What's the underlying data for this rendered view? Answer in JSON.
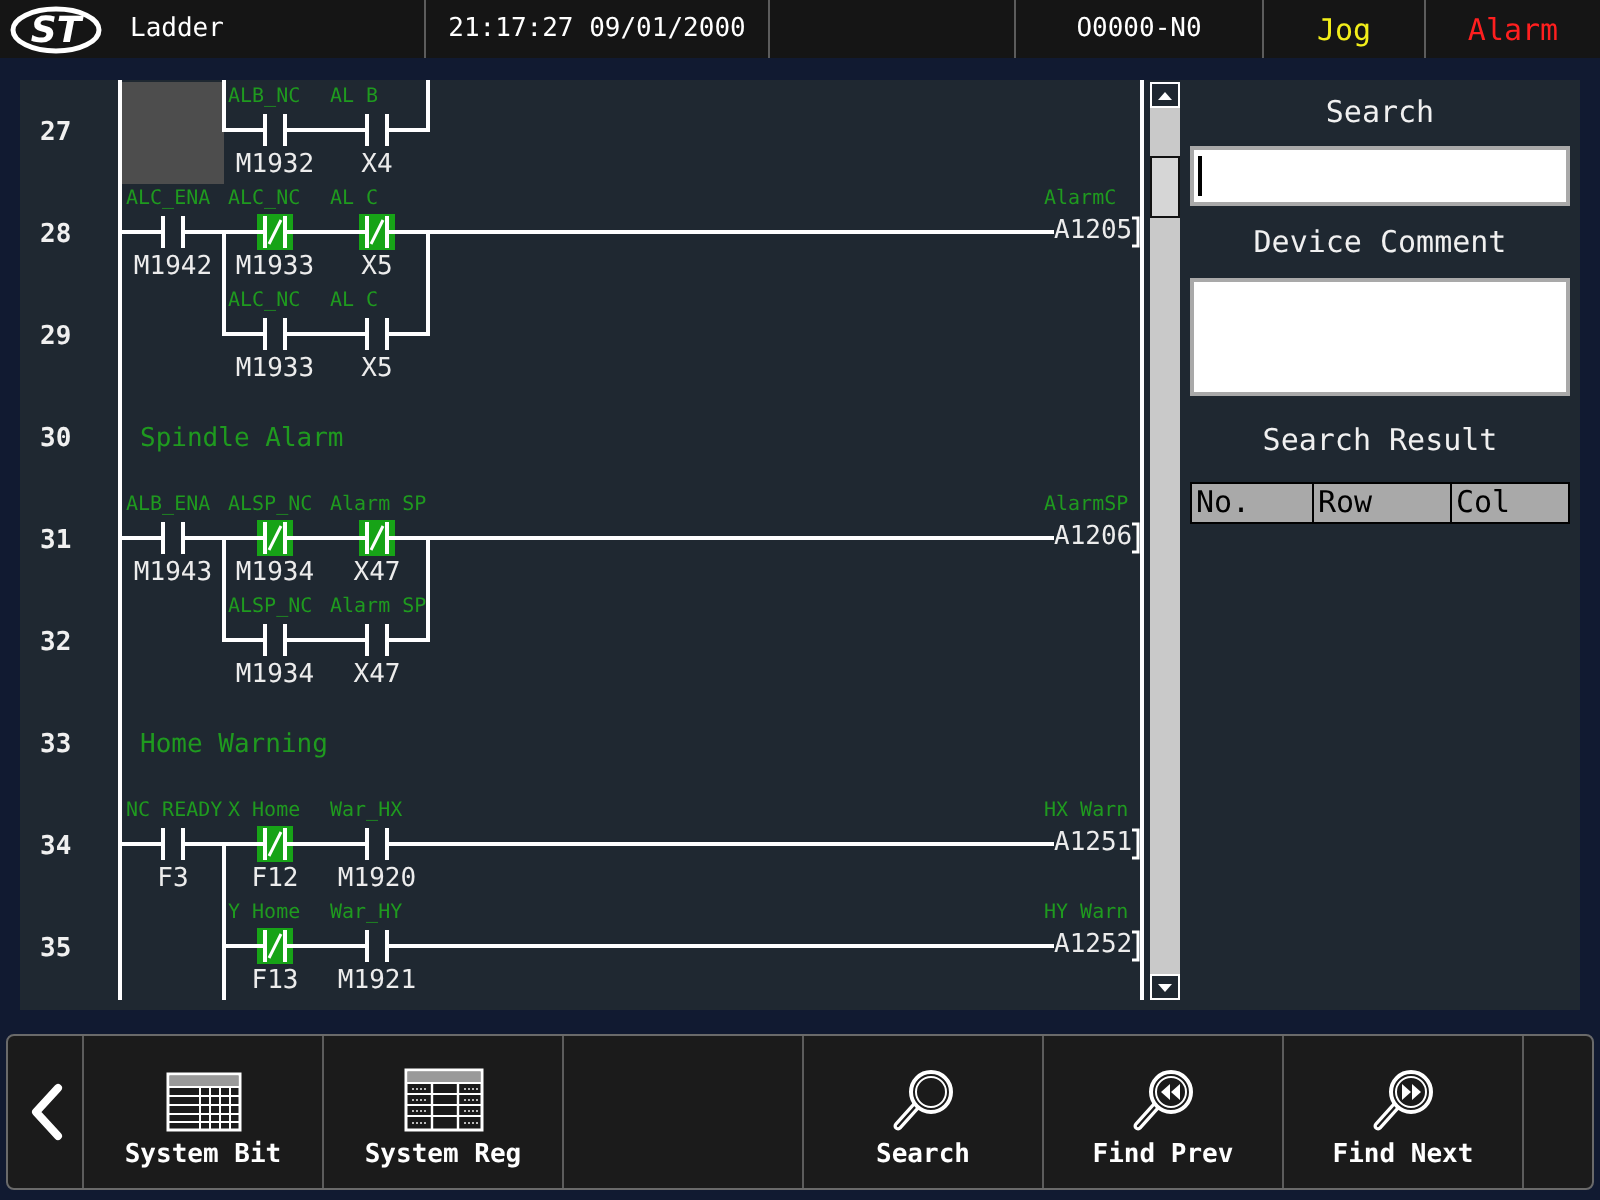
{
  "header": {
    "logo": "ST",
    "screen": "Ladder",
    "clock": "21:17:27 09/01/2000",
    "program": "O0000-N0",
    "mode": "Jog",
    "alarm": "Alarm"
  },
  "ladder": {
    "rows": [
      {
        "number": "27",
        "kind": "rung",
        "cells": [
          {
            "kind": "cursor"
          },
          {
            "kind": "open",
            "on": false,
            "comment": "ALB_NC",
            "device": "M1932"
          },
          {
            "kind": "open",
            "on": false,
            "comment": "AL B",
            "device": "X4"
          }
        ],
        "continues_below": false
      },
      {
        "number": "28",
        "kind": "rung",
        "cells": [
          {
            "kind": "open",
            "on": false,
            "comment": "ALC_ENA",
            "device": "M1942"
          },
          {
            "kind": "closed",
            "on": true,
            "comment": "ALC_NC",
            "device": "M1933"
          },
          {
            "kind": "closed",
            "on": true,
            "comment": "AL C",
            "device": "X5"
          }
        ],
        "coil": {
          "comment": "AlarmC",
          "device": "A1205"
        },
        "continues_below": false
      },
      {
        "number": "29",
        "kind": "rung",
        "cells": [
          {
            "kind": "empty"
          },
          {
            "kind": "open",
            "on": false,
            "comment": "ALC_NC",
            "device": "M1933"
          },
          {
            "kind": "open",
            "on": false,
            "comment": "AL C",
            "device": "X5"
          }
        ],
        "continues_below": false
      },
      {
        "number": "30",
        "kind": "comment",
        "text": "Spindle Alarm"
      },
      {
        "number": "31",
        "kind": "rung",
        "cells": [
          {
            "kind": "open",
            "on": false,
            "comment": "ALB_ENA",
            "device": "M1943"
          },
          {
            "kind": "closed",
            "on": true,
            "comment": "ALSP_NC",
            "device": "M1934"
          },
          {
            "kind": "closed",
            "on": true,
            "comment": "Alarm SP",
            "device": "X47"
          }
        ],
        "coil": {
          "comment": "AlarmSP",
          "device": "A1206"
        },
        "continues_below": false
      },
      {
        "number": "32",
        "kind": "rung",
        "cells": [
          {
            "kind": "empty"
          },
          {
            "kind": "open",
            "on": false,
            "comment": "ALSP_NC",
            "device": "M1934"
          },
          {
            "kind": "open",
            "on": false,
            "comment": "Alarm SP",
            "device": "X47"
          }
        ],
        "continues_below": false
      },
      {
        "number": "33",
        "kind": "comment",
        "text": "Home Warning"
      },
      {
        "number": "34",
        "kind": "rung",
        "cells": [
          {
            "kind": "open",
            "on": false,
            "comment": "NC READY",
            "device": "F3"
          },
          {
            "kind": "closed",
            "on": true,
            "comment": "X Home",
            "device": "F12"
          },
          {
            "kind": "open",
            "on": false,
            "comment": "War_HX",
            "device": "M1920"
          }
        ],
        "coil": {
          "comment": "HX Warn",
          "device": "A1251"
        },
        "continues_below": false
      },
      {
        "number": "35",
        "kind": "rung",
        "cells": [
          {
            "kind": "empty"
          },
          {
            "kind": "closed",
            "on": true,
            "comment": "Y Home",
            "device": "F13"
          },
          {
            "kind": "open",
            "on": false,
            "comment": "War_HY",
            "device": "M1921"
          }
        ],
        "coil": {
          "comment": "HY Warn",
          "device": "A1252"
        },
        "continues_below": true
      }
    ]
  },
  "search_panel": {
    "title": "Search",
    "search_field": {
      "focused": true
    },
    "comment_title": "Device Comment",
    "result_title": "Search Result",
    "result_columns": [
      "No.",
      "Row",
      "Col"
    ]
  },
  "toolbar": {
    "buttons": [
      {
        "kind": "back"
      },
      {
        "kind": "bits",
        "label": "System Bit"
      },
      {
        "kind": "registers",
        "label": "System Reg"
      },
      {
        "kind": "empty"
      },
      {
        "kind": "search",
        "label": "Search"
      },
      {
        "kind": "prev",
        "label": "Find Prev"
      },
      {
        "kind": "next",
        "label": "Find Next"
      },
      {
        "kind": "empty"
      }
    ]
  }
}
